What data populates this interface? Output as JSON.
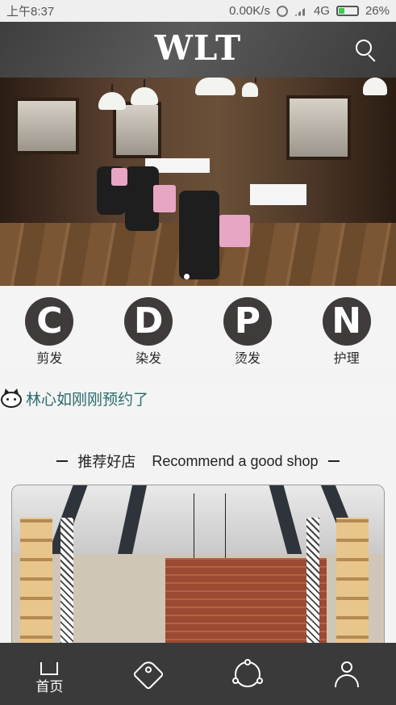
{
  "status_bar": {
    "time": "上午8:37",
    "network_speed": "0.00K/s",
    "network_type": "4G",
    "battery": "26%"
  },
  "header": {
    "brand": "WLT",
    "search_icon": "search-icon"
  },
  "banner": {
    "carousel_index": 1,
    "carousel_total": 1
  },
  "categories": [
    {
      "letter": "C",
      "label": "剪发"
    },
    {
      "letter": "D",
      "label": "染发"
    },
    {
      "letter": "P",
      "label": "烫发"
    },
    {
      "letter": "N",
      "label": "护理"
    }
  ],
  "ticker": {
    "icon": "cat-face-icon",
    "text": "林心如刚刚预约了"
  },
  "recommend": {
    "title_cn": "推荐好店",
    "title_en": "Recommend a good shop"
  },
  "bottom_nav": [
    {
      "icon": "home-icon",
      "label": "首页",
      "active": true
    },
    {
      "icon": "tag-icon",
      "label": ""
    },
    {
      "icon": "share-icon",
      "label": ""
    },
    {
      "icon": "user-icon",
      "label": ""
    }
  ],
  "colors": {
    "header_bg": "#4a4a4a",
    "circle_bg": "#3f3b3b",
    "ticker_text": "#2c6b6e",
    "nav_bg": "#3a3a3a",
    "battery": "#46c35a"
  }
}
